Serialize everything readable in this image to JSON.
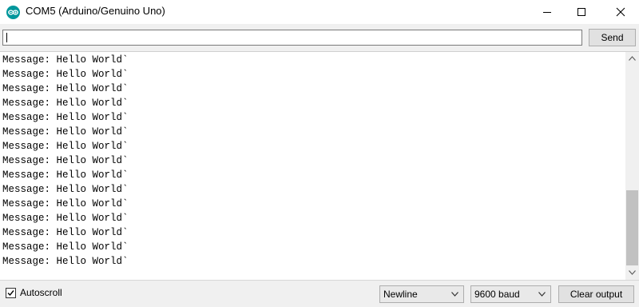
{
  "window": {
    "title": "COM5 (Arduino/Genuino Uno)",
    "app_icon": "arduino-logo-icon",
    "controls": [
      "minimize-icon",
      "maximize-icon",
      "close-icon"
    ]
  },
  "input_bar": {
    "value": "",
    "send_label": "Send"
  },
  "output": {
    "lines": [
      "Message: Hello World`",
      "Message: Hello World`",
      "Message: Hello World`",
      "Message: Hello World`",
      "Message: Hello World`",
      "Message: Hello World`",
      "Message: Hello World`",
      "Message: Hello World`",
      "Message: Hello World`",
      "Message: Hello World`",
      "Message: Hello World`",
      "Message: Hello World`",
      "Message: Hello World`",
      "Message: Hello World`",
      "Message: Hello World`"
    ]
  },
  "bottom_bar": {
    "autoscroll_label": "Autoscroll",
    "autoscroll_checked": true,
    "line_ending": "Newline",
    "baud_rate": "9600 baud",
    "clear_label": "Clear output"
  },
  "colors": {
    "accent": "#00979c",
    "chrome": "#f0f0f0",
    "button": "#e1e1e1"
  }
}
